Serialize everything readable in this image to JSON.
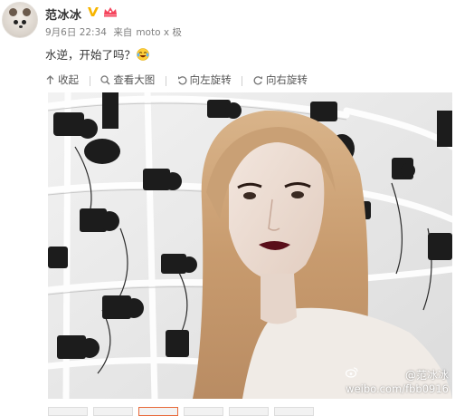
{
  "post": {
    "username": "范冰冰",
    "time": "9月6日 22:34",
    "source_prefix": "来自",
    "source": "moto x 极",
    "text": "水逆，开始了吗？"
  },
  "toolbar": {
    "collapse_label": "收起",
    "view_large_label": "查看大图",
    "rotate_left_label": "向左旋转",
    "rotate_right_label": "向右旋转"
  },
  "watermark": {
    "handle": "@范冰冰",
    "url": "weibo.com/fbb0916"
  },
  "icons": {
    "verify": "verified-v-icon",
    "vip": "vip-crown-icon",
    "emoji": "laugh-cry-emoji-icon"
  },
  "colors": {
    "verify": "#f7b500",
    "vip": "#f5455d",
    "thumb_active": "#e86a3a"
  }
}
